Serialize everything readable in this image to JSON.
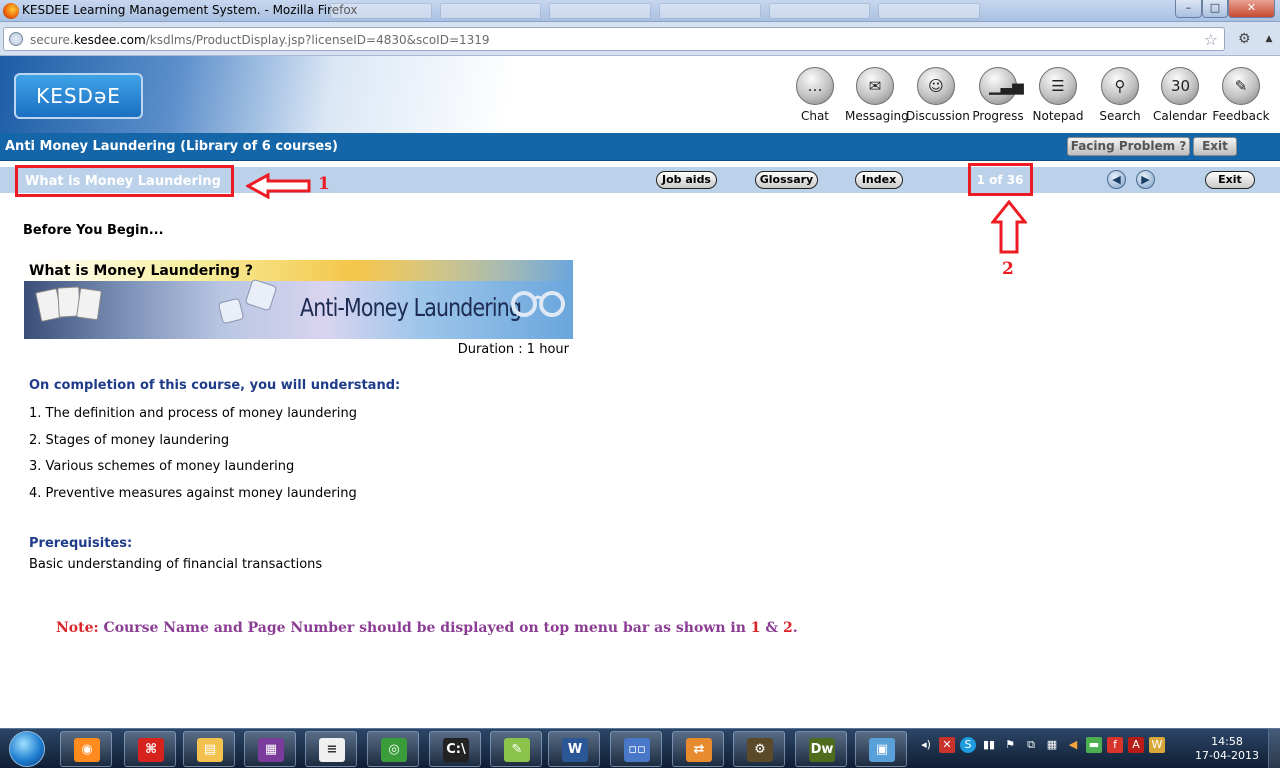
{
  "window": {
    "title": "KESDEE Learning Management System. - Mozilla Firefox",
    "min_glyph": "–",
    "max_glyph": "□",
    "close_glyph": "✕"
  },
  "urlbar": {
    "url_prefix": "secure.",
    "url_domain": "kesdee.com",
    "url_rest": "/ksdlms/ProductDisplay.jsp?licenseID=4830&scoID=1319"
  },
  "header": {
    "logo_text": "KESDəE",
    "tools": [
      {
        "label": "Chat",
        "glyph": "…"
      },
      {
        "label": "Messaging",
        "glyph": "✉"
      },
      {
        "label": "Discussion",
        "glyph": "☺"
      },
      {
        "label": "Progress",
        "glyph": "▁▃▅"
      },
      {
        "label": "Notepad",
        "glyph": "☰"
      },
      {
        "label": "Search",
        "glyph": "⚲"
      },
      {
        "label": "Calendar",
        "glyph": "30"
      },
      {
        "label": "Feedback",
        "glyph": "✎"
      }
    ]
  },
  "coursebar": {
    "title": "Anti Money Laundering (Library of 6 courses)",
    "facing_problem": "Facing Problem ?",
    "exit": "Exit"
  },
  "navbar": {
    "topic": "What is Money Laundering",
    "job_aids": "Job aids",
    "glossary": "Glossary",
    "index": "Index",
    "page": "1 of 36",
    "exit": "Exit"
  },
  "annotations": {
    "one": "1",
    "two": "2"
  },
  "content": {
    "before": "Before You Begin...",
    "banner_caption": "What is Money Laundering ?",
    "banner_title": "Anti-Money Laundering",
    "duration": "Duration : 1 hour",
    "completion_heading": "On completion of this course, you will understand:",
    "objectives": [
      "1.  The definition and process of money laundering",
      "2.  Stages of money laundering",
      "3.  Various schemes of money laundering",
      "4.  Preventive measures against money laundering"
    ],
    "prereq_heading": "Prerequisites:",
    "prereq_text": "Basic understanding of financial transactions",
    "note_label": "Note:",
    "note_text": " Course Name and Page Number should be displayed on top menu bar as shown in ",
    "note_one": "1",
    "note_amp": " & ",
    "note_two": "2",
    "note_end": "."
  },
  "taskbar": {
    "apps": [
      {
        "name": "firefox",
        "glyph": "◉",
        "color": "#ff8a1e"
      },
      {
        "name": "acrobat",
        "glyph": "⌘",
        "color": "#d6231d"
      },
      {
        "name": "explorer",
        "glyph": "▤",
        "color": "#f2c14e"
      },
      {
        "name": "winrar",
        "glyph": "▦",
        "color": "#7b3b9a"
      },
      {
        "name": "notepad",
        "glyph": "≡",
        "color": "#f0f0f0"
      },
      {
        "name": "chrome",
        "glyph": "◎",
        "color": "#3a9d3a"
      },
      {
        "name": "cmd",
        "glyph": "C:\\",
        "color": "#222222"
      },
      {
        "name": "editplus",
        "glyph": "✎",
        "color": "#8bc34a"
      },
      {
        "name": "word",
        "glyph": "W",
        "color": "#2b5797"
      },
      {
        "name": "network",
        "glyph": "▫▫",
        "color": "#4a78c8"
      },
      {
        "name": "transfer",
        "glyph": "⇄",
        "color": "#e88a2e"
      },
      {
        "name": "javaee-ide",
        "glyph": "⚙",
        "color": "#5a4a2a"
      },
      {
        "name": "dreamweaver",
        "glyph": "Dw",
        "color": "#4e6b1e"
      },
      {
        "name": "photo-viewer",
        "glyph": "▣",
        "color": "#5aa0d8"
      }
    ],
    "time": "14:58",
    "date": "17-04-2013"
  }
}
